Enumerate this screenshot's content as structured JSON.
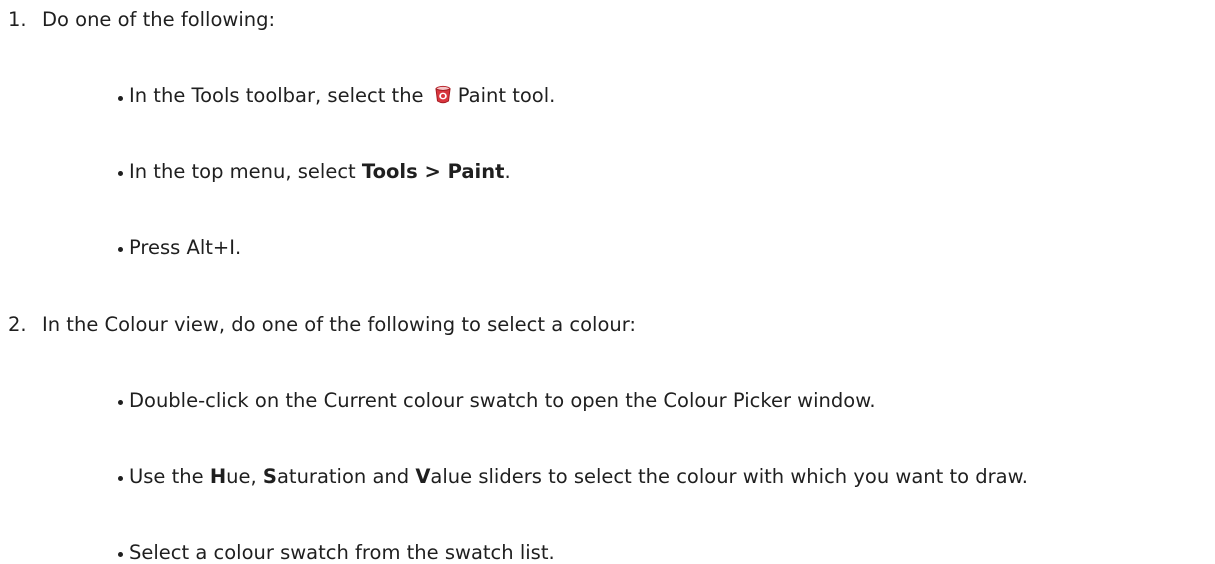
{
  "steps": [
    {
      "number": "1.",
      "text": "Do one of the following:",
      "bullets": {
        "b1": {
          "pre": "In the Tools toolbar, select the ",
          "post": "Paint tool.",
          "icon": "paint-bucket-icon"
        },
        "b2": {
          "pre": "In the top menu, select ",
          "bold": "Tools > Paint",
          "post": "."
        },
        "b3": {
          "text": "Press Alt+I."
        }
      }
    },
    {
      "number": "2.",
      "text": "In the Colour view, do one of the following to select a colour:",
      "bullets": {
        "b1": {
          "text": "Double-click on the Current colour swatch to open the Colour Picker window."
        },
        "b2": {
          "pre": "Use the ",
          "h_bold": "H",
          "h_rest": "ue, ",
          "s_bold": "S",
          "s_rest": "aturation and ",
          "v_bold": "V",
          "v_rest": "alue sliders to select the colour with which you want to draw."
        },
        "b3": {
          "text": "Select a colour swatch from the swatch list."
        }
      }
    }
  ],
  "colors": {
    "text": "#1f1f1f",
    "paint_icon": "#d9363e"
  }
}
